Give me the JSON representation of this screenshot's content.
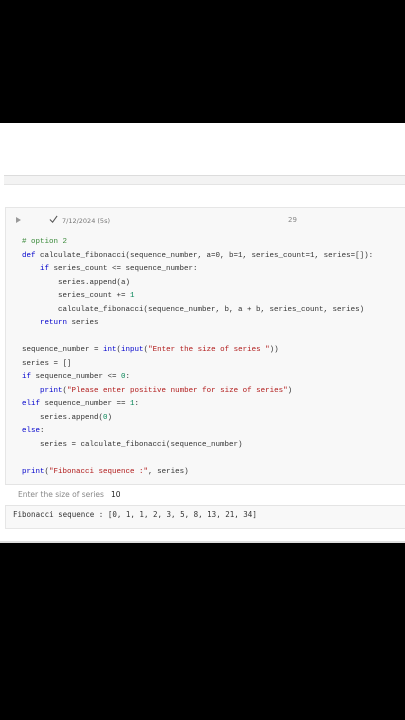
{
  "cell": {
    "run_icon": "play-icon",
    "status_icon": "check-icon",
    "exec_time": "7/12/2024 (5s)",
    "exec_count": "29"
  },
  "code": {
    "l1": "# option 2",
    "l2_kw": "def",
    "l2_rest": " calculate_fibonacci(sequence_number, a=0, b=1, series_count=1, series=[]):",
    "l3_kw": "if",
    "l3_rest": " series_count <= sequence_number:",
    "l4": "series.append(a)",
    "l5_a": "series_count += ",
    "l5_b": "1",
    "l6": "calculate_fibonacci(sequence_number, b, a + b, series_count, series)",
    "l7_kw": "return",
    "l7_rest": " series",
    "l8_a": "sequence_number = ",
    "l8_kw": "int",
    "l8_b": "(",
    "l8_kw2": "input",
    "l8_c": "(",
    "l8_str": "\"Enter the size of series \"",
    "l8_d": "))",
    "l9": "series = []",
    "l10_kw": "if",
    "l10_a": " sequence_number <= ",
    "l10_b": "0",
    "l10_c": ":",
    "l11_kw": "print",
    "l11_a": "(",
    "l11_str": "\"Please enter positive number for size of series\"",
    "l11_b": ")",
    "l12_kw": "elif",
    "l12_a": " sequence_number == ",
    "l12_b": "1",
    "l12_c": ":",
    "l13_a": "series.append(",
    "l13_b": "0",
    "l13_c": ")",
    "l14_kw": "else",
    "l14_a": ":",
    "l15": "series = calculate_fibonacci(sequence_number)",
    "l16_kw": "print",
    "l16_a": "(",
    "l16_str": "\"Fibonacci sequence :\"",
    "l16_b": ", series)"
  },
  "input_prompt": {
    "label": "Enter the size of series",
    "value": "10"
  },
  "output": {
    "text": "Fibonacci sequence : [0, 1, 1, 2, 3, 5, 8, 13, 21, 34]"
  }
}
